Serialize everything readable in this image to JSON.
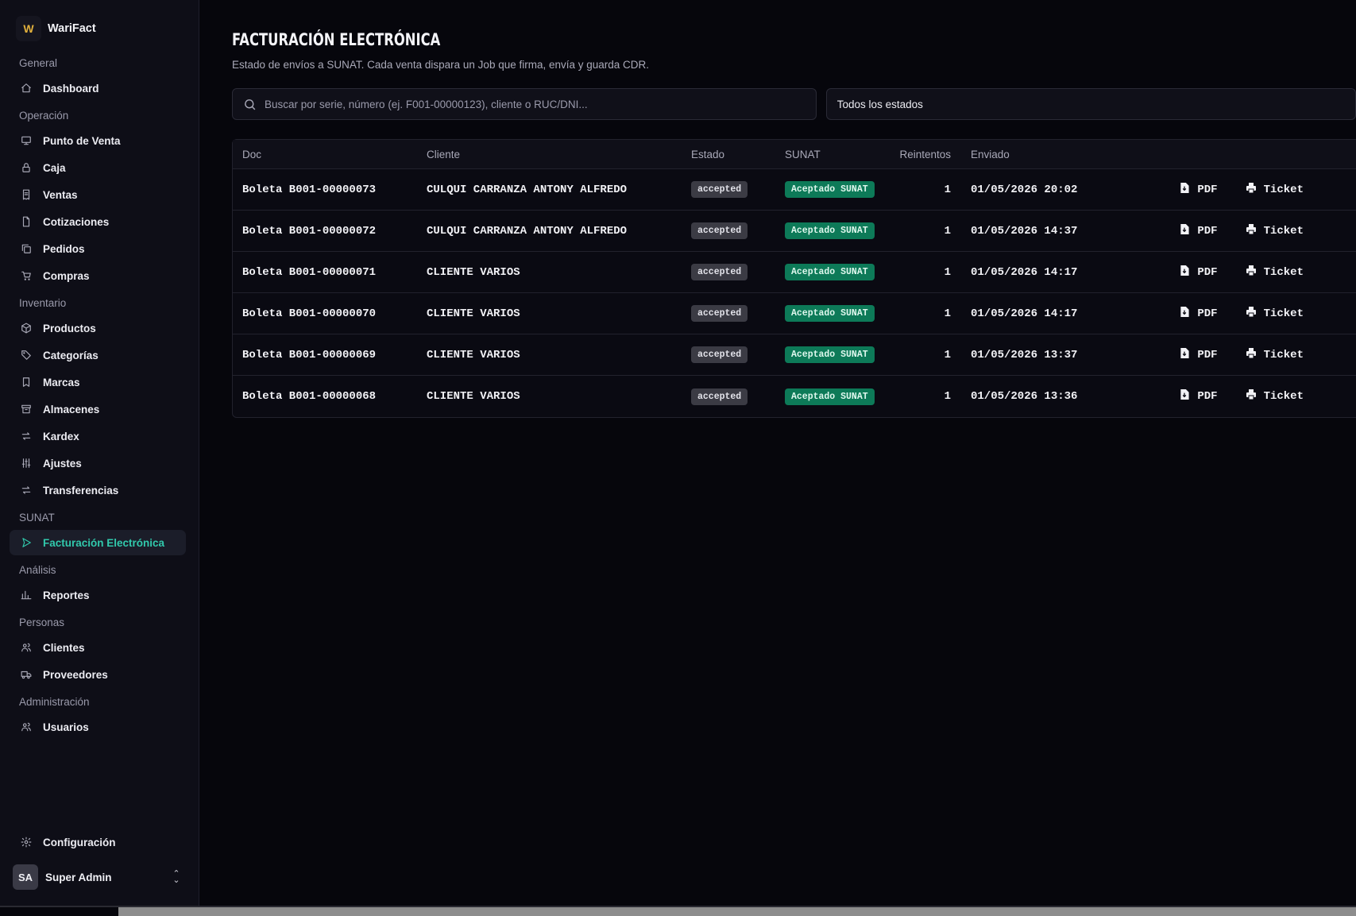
{
  "app": {
    "name": "WariFact",
    "logo_letter": "W"
  },
  "sidebar": {
    "groups": [
      {
        "label": "General",
        "items": [
          {
            "label": "Dashboard",
            "icon": "home-icon"
          }
        ]
      },
      {
        "label": "Operación",
        "items": [
          {
            "label": "Punto de Venta",
            "icon": "monitor-icon"
          },
          {
            "label": "Caja",
            "icon": "lock-icon"
          },
          {
            "label": "Ventas",
            "icon": "receipt-icon"
          },
          {
            "label": "Cotizaciones",
            "icon": "file-icon"
          },
          {
            "label": "Pedidos",
            "icon": "copy-icon"
          },
          {
            "label": "Compras",
            "icon": "cart-icon"
          }
        ]
      },
      {
        "label": "Inventario",
        "items": [
          {
            "label": "Productos",
            "icon": "box-icon"
          },
          {
            "label": "Categorías",
            "icon": "tag-icon"
          },
          {
            "label": "Marcas",
            "icon": "bookmark-icon"
          },
          {
            "label": "Almacenes",
            "icon": "archive-icon"
          },
          {
            "label": "Kardex",
            "icon": "arrows-icon"
          },
          {
            "label": "Ajustes",
            "icon": "sliders-icon"
          },
          {
            "label": "Transferencias",
            "icon": "transfer-icon"
          }
        ]
      },
      {
        "label": "SUNAT",
        "items": [
          {
            "label": "Facturación Electrónica",
            "icon": "send-icon",
            "active": true
          }
        ]
      },
      {
        "label": "Análisis",
        "items": [
          {
            "label": "Reportes",
            "icon": "bar-chart-icon"
          }
        ]
      },
      {
        "label": "Personas",
        "items": [
          {
            "label": "Clientes",
            "icon": "users-icon"
          },
          {
            "label": "Proveedores",
            "icon": "truck-icon"
          }
        ]
      },
      {
        "label": "Administración",
        "items": [
          {
            "label": "Usuarios",
            "icon": "user-group-icon"
          }
        ]
      }
    ],
    "config_label": "Configuración",
    "user": {
      "initials": "SA",
      "name": "Super Admin"
    }
  },
  "page": {
    "title": "FACTURACIÓN ELECTRÓNICA",
    "subtitle": "Estado de envíos a SUNAT. Cada venta dispara un Job que firma, envía y guarda CDR.",
    "search_placeholder": "Buscar por serie, número (ej. F001-00000123), cliente o RUC/DNI...",
    "status_filter": "Todos los estados"
  },
  "table": {
    "columns": [
      "Doc",
      "Cliente",
      "Estado",
      "SUNAT",
      "Reintentos",
      "Enviado"
    ],
    "actions": {
      "pdf": "PDF",
      "ticket": "Ticket"
    },
    "rows": [
      {
        "doc": "Boleta B001-00000073",
        "cliente": "CULQUI CARRANZA ANTONY ALFREDO",
        "estado": "accepted",
        "sunat": "Aceptado SUNAT",
        "reintentos": "1",
        "enviado": "01/05/2026 20:02"
      },
      {
        "doc": "Boleta B001-00000072",
        "cliente": "CULQUI CARRANZA ANTONY ALFREDO",
        "estado": "accepted",
        "sunat": "Aceptado SUNAT",
        "reintentos": "1",
        "enviado": "01/05/2026 14:37"
      },
      {
        "doc": "Boleta B001-00000071",
        "cliente": "CLIENTE VARIOS",
        "estado": "accepted",
        "sunat": "Aceptado SUNAT",
        "reintentos": "1",
        "enviado": "01/05/2026 14:17"
      },
      {
        "doc": "Boleta B001-00000070",
        "cliente": "CLIENTE VARIOS",
        "estado": "accepted",
        "sunat": "Aceptado SUNAT",
        "reintentos": "1",
        "enviado": "01/05/2026 14:17"
      },
      {
        "doc": "Boleta B001-00000069",
        "cliente": "CLIENTE VARIOS",
        "estado": "accepted",
        "sunat": "Aceptado SUNAT",
        "reintentos": "1",
        "enviado": "01/05/2026 13:37"
      },
      {
        "doc": "Boleta B001-00000068",
        "cliente": "CLIENTE VARIOS",
        "estado": "accepted",
        "sunat": "Aceptado SUNAT",
        "reintentos": "1",
        "enviado": "01/05/2026 13:36"
      }
    ]
  },
  "colors": {
    "accent": "#31c9ac",
    "badge_green": "#0d7a58",
    "badge_gray": "#3b3b44",
    "background": "#06060c"
  }
}
